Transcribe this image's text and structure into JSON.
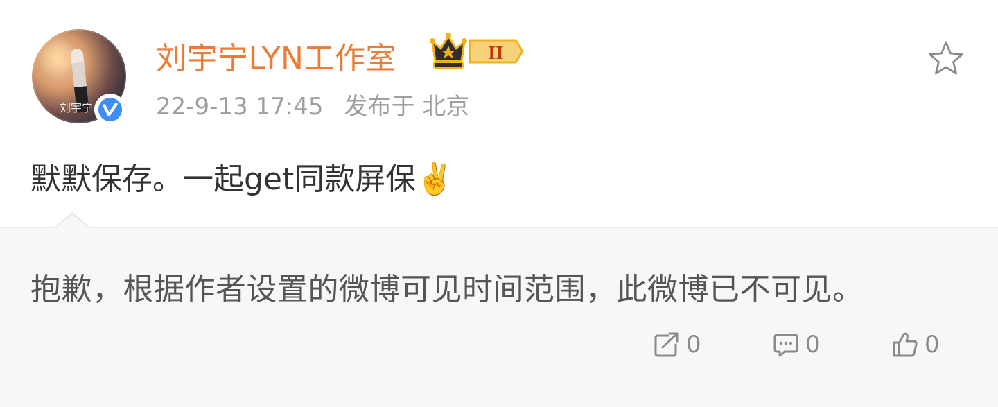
{
  "author": {
    "name": "刘宇宁LYN工作室",
    "vip_level": "II",
    "avatar_signature": "刘宇宁"
  },
  "meta": {
    "timestamp": "22-9-13 17:45",
    "location": "发布于 北京"
  },
  "post": {
    "text": "默默保存。一起get同款屏保✌️"
  },
  "retweet": {
    "notice": "抱歉，根据作者设置的微博可见时间范围，此微博已不可见。",
    "actions": {
      "repost_count": "0",
      "comment_count": "0",
      "like_count": "0"
    }
  },
  "colors": {
    "username": "#ee7a33",
    "verified_blue": "#3d8ef6",
    "gold": "#f2b11b",
    "icon_gray": "#8a8a8a"
  },
  "icons": [
    "verified-icon",
    "crown-vip-icon",
    "star-icon",
    "repost-icon",
    "comment-icon",
    "like-icon"
  ]
}
